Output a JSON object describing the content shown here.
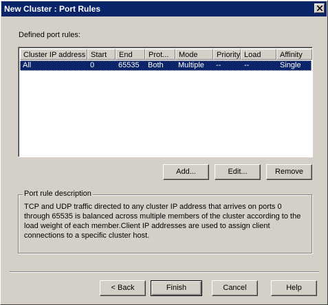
{
  "window": {
    "title": "New Cluster : Port Rules"
  },
  "port_rules": {
    "label": "Defined port rules:",
    "columns": [
      "Cluster IP address",
      "Start",
      "End",
      "Prot...",
      "Mode",
      "Priority",
      "Load",
      "Affinity"
    ],
    "rows": [
      {
        "cluster_ip": "All",
        "start": "0",
        "end": "65535",
        "protocol": "Both",
        "mode": "Multiple",
        "priority": "--",
        "load": "--",
        "affinity": "Single"
      }
    ]
  },
  "rule_buttons": {
    "add": "Add...",
    "edit": "Edit...",
    "remove": "Remove"
  },
  "description": {
    "title": "Port rule description",
    "text": "TCP and UDP traffic directed to any cluster IP address that arrives on ports 0 through 65535 is balanced across multiple members of the cluster according to the load weight of each member.Client IP addresses are used to assign client connections to a specific cluster host."
  },
  "wizard_buttons": {
    "back": "< Back",
    "finish": "Finish",
    "cancel": "Cancel",
    "help": "Help"
  }
}
